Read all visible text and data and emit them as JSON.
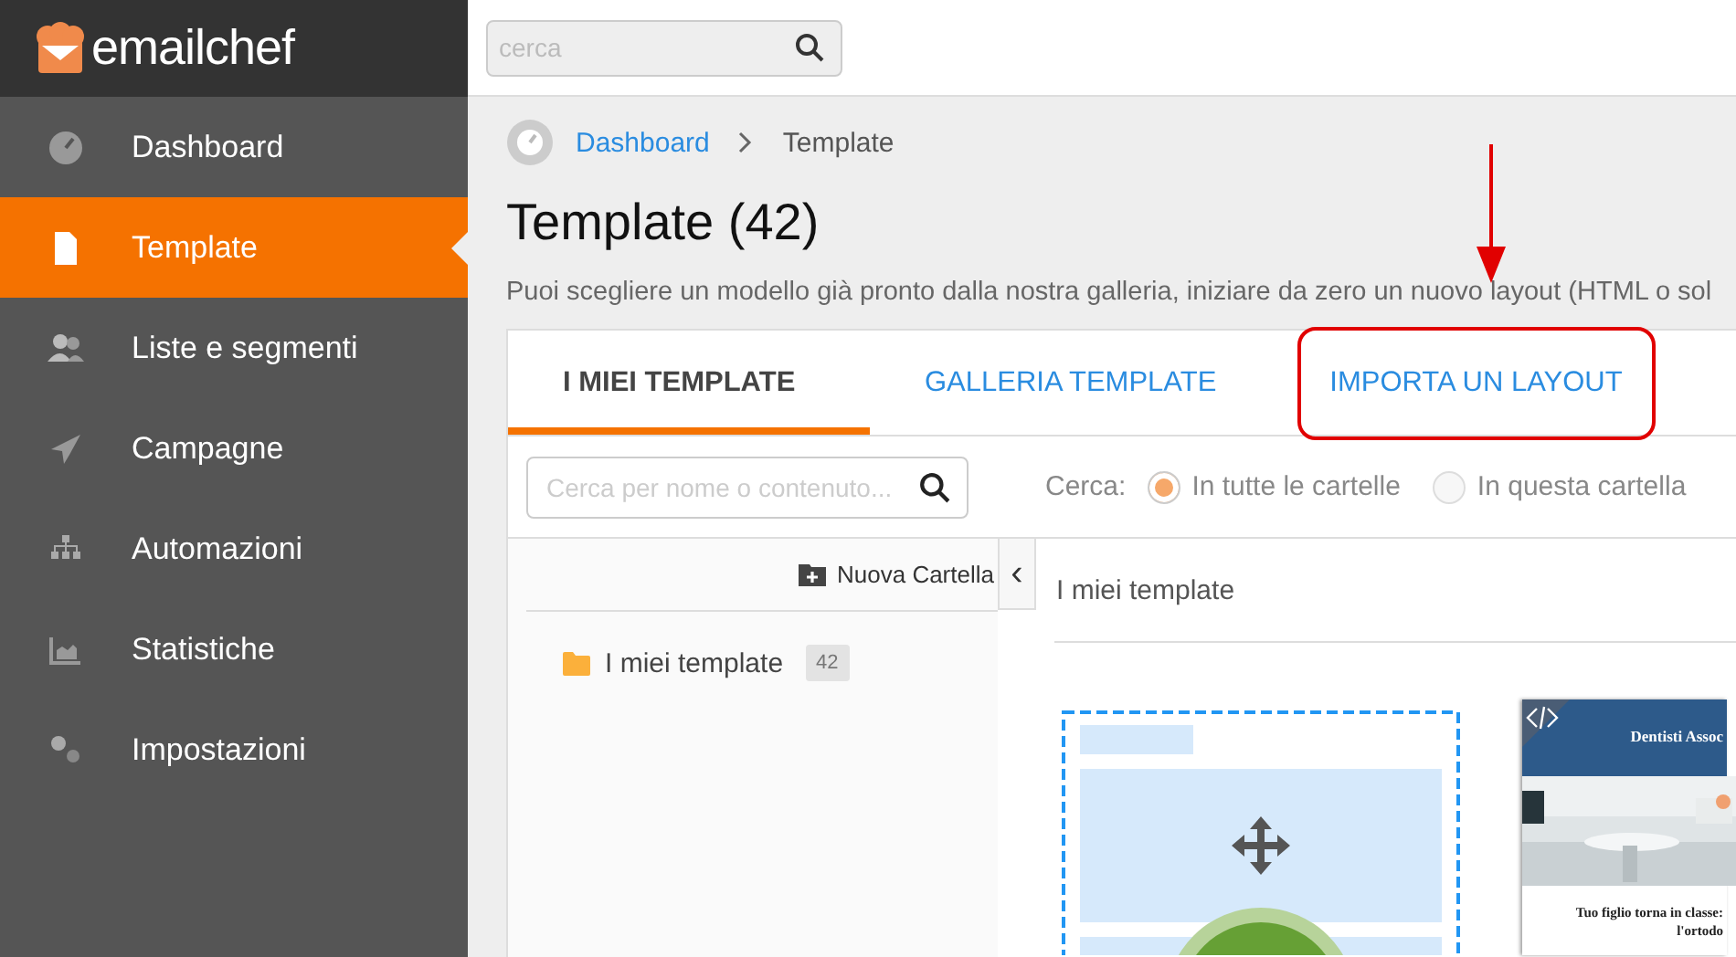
{
  "brand": {
    "name": "emailchef"
  },
  "sidebar": {
    "items": [
      {
        "label": "Dashboard",
        "selected": false
      },
      {
        "label": "Template",
        "selected": true
      },
      {
        "label": "Liste e segmenti",
        "selected": false
      },
      {
        "label": "Campagne",
        "selected": false
      },
      {
        "label": "Automazioni",
        "selected": false
      },
      {
        "label": "Statistiche",
        "selected": false
      },
      {
        "label": "Impostazioni",
        "selected": false
      }
    ]
  },
  "topbar": {
    "search": {
      "placeholder": "cerca"
    }
  },
  "breadcrumb": [
    {
      "label": "Dashboard",
      "kind": "link"
    },
    {
      "label": "Template",
      "kind": "current"
    }
  ],
  "page": {
    "title": "Template (42)",
    "description": "Puoi scegliere un modello già pronto dalla nostra galleria, iniziare da zero un nuovo layout (HTML o sol"
  },
  "tabs": [
    {
      "label": "I MIEI TEMPLATE",
      "selected": true,
      "highlighted": false
    },
    {
      "label": "GALLERIA TEMPLATE",
      "selected": false,
      "highlighted": false
    },
    {
      "label": "IMPORTA UN LAYOUT",
      "selected": false,
      "highlighted": true
    }
  ],
  "filter": {
    "search": {
      "placeholder": "Cerca per nome o contenuto..."
    },
    "label": "Cerca:",
    "options": [
      {
        "label": "In tutte le cartelle",
        "selected": true
      },
      {
        "label": "In questa cartella",
        "selected": false
      }
    ]
  },
  "folders": {
    "new_button": "Nuova Cartella",
    "collapse": "‹",
    "items": [
      {
        "label": "I miei template",
        "count": "42",
        "color": "#fbb03b"
      }
    ]
  },
  "content": {
    "heading": "I miei template",
    "templates": [
      {
        "kind": "placeholder"
      },
      {
        "kind": "email",
        "title": "Dentisti Assoc",
        "lines": [
          "Tuo figlio torna in classe:",
          "l'ortodo"
        ]
      }
    ]
  }
}
